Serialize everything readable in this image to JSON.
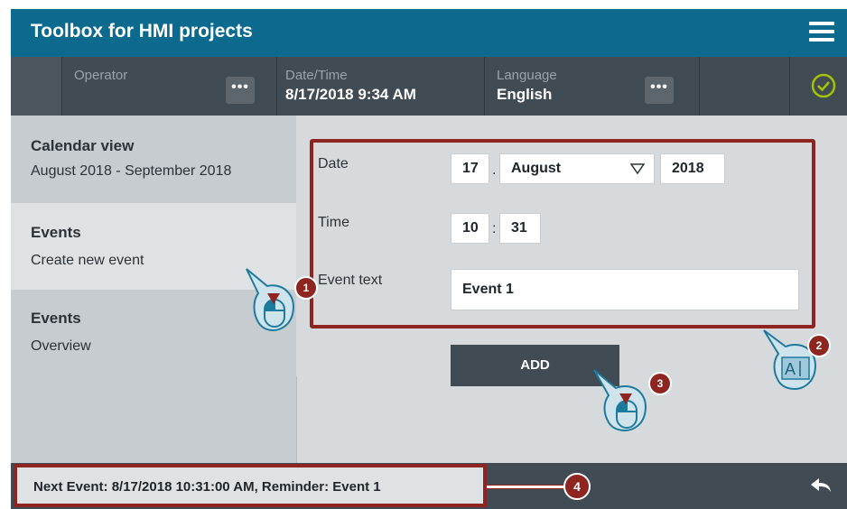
{
  "app": {
    "title": "Toolbox for HMI projects"
  },
  "status_bar": {
    "operator_label": "Operator",
    "operator_more": "•••",
    "datetime_label": "Date/Time",
    "datetime_value": "8/17/2018 9:34 AM",
    "language_label": "Language",
    "language_value": "English",
    "language_more": "•••"
  },
  "sidebar": {
    "items": [
      {
        "title": "Calendar view",
        "subtitle": "August 2018 - September 2018"
      },
      {
        "title": "Events",
        "subtitle": "Create new event"
      },
      {
        "title": "Events",
        "subtitle": "Overview"
      },
      {
        "title": "",
        "subtitle": ""
      }
    ]
  },
  "form": {
    "date_label": "Date",
    "date_day": "17",
    "date_sep": ".",
    "date_month": "August",
    "date_year": "2018",
    "time_label": "Time",
    "time_hour": "10",
    "time_sep": ":",
    "time_minute": "31",
    "event_text_label": "Event text",
    "event_text_value": "Event 1",
    "add_label": "ADD"
  },
  "bottom_bar": {
    "next_event": "Next Event: 8/17/2018 10:31:00 AM,    Reminder: Event 1"
  },
  "callouts": [
    "1",
    "2",
    "3",
    "4"
  ],
  "colors": {
    "title_bar": "#0b6a8e",
    "status_bar": "#414b53",
    "annotation_red": "#8f2520",
    "ok_green": "#a5c400"
  },
  "icons": [
    "menu-icon",
    "more-icon",
    "check-circle-icon",
    "dropdown-arrow-icon",
    "back-icon",
    "mouse-icon",
    "text-input-icon"
  ]
}
